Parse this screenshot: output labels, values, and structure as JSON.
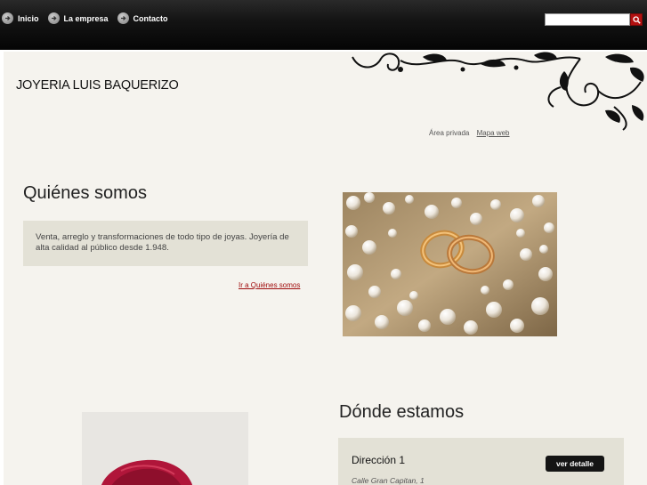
{
  "nav": {
    "items": [
      {
        "label": "Inicio"
      },
      {
        "label": "La empresa"
      },
      {
        "label": "Contacto"
      }
    ]
  },
  "search": {
    "value": "",
    "placeholder": ""
  },
  "header": {
    "logo": "JOYERIA LUIS BAQUERIZO"
  },
  "toplinks": {
    "private": "Área privada",
    "sitemap": "Mapa web"
  },
  "about": {
    "title": "Quiénes somos",
    "text": "Venta, arreglo y transformaciones de todo tipo de joyas. Joyería de alta calidad al público desde 1.948.",
    "link": "Ir a Quiénes somos"
  },
  "location": {
    "title": "Dónde estamos",
    "address_title": "Dirección 1",
    "detail_button": "ver detalle",
    "street": "Calle  Gran Capitan, 1"
  },
  "colors": {
    "topbar": "#141414",
    "page_bg": "#f5f3ee",
    "box_bg": "#e3e1d6",
    "accent_link": "#a00d0d",
    "search_button": "#b31010"
  }
}
